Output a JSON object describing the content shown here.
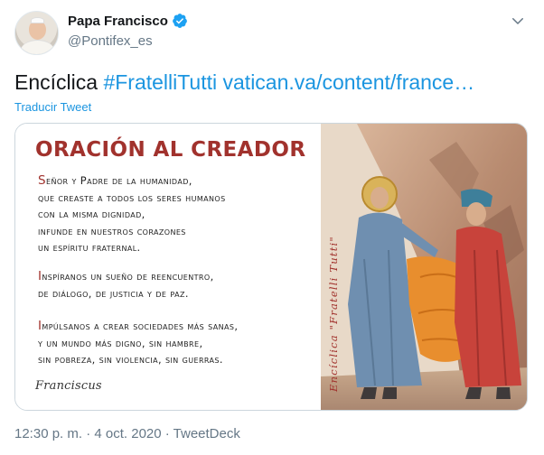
{
  "author": {
    "display_name": "Papa Francisco",
    "handle": "@Pontifex_es",
    "verified": true,
    "avatar_icon": "avatar-photo"
  },
  "tweet": {
    "text_plain": "Encíclica ",
    "hashtag": "#FratelliTutti",
    "link": "vatican.va/content/france…",
    "translate_label": "Traducir Tweet"
  },
  "image": {
    "title": "ORACIÓN AL CREADOR",
    "stanzas": [
      [
        "Señor y Padre de la humanidad,",
        "que creaste a todos los seres humanos",
        "con la misma dignidad,",
        "infunde en nuestros corazones",
        "un espíritu fraternal."
      ],
      [
        "Inspíranos un sueño de reencuentro,",
        "de diálogo, de justicia y de paz."
      ],
      [
        "Impúlsanos a crear sociedades más sanas,",
        "y un mundo más digno, sin hambre,",
        "sin pobreza, sin violencia, sin guerras."
      ]
    ],
    "signature": "Franciscus",
    "vertical_caption": "Encíclica \"Fratelli Tutti\""
  },
  "footer": {
    "text": "12:30 p. m. · 4 oct. 2020 · TweetDeck"
  },
  "colors": {
    "link": "#1b95e0",
    "title_red": "#a1322d",
    "muted": "#657786"
  }
}
